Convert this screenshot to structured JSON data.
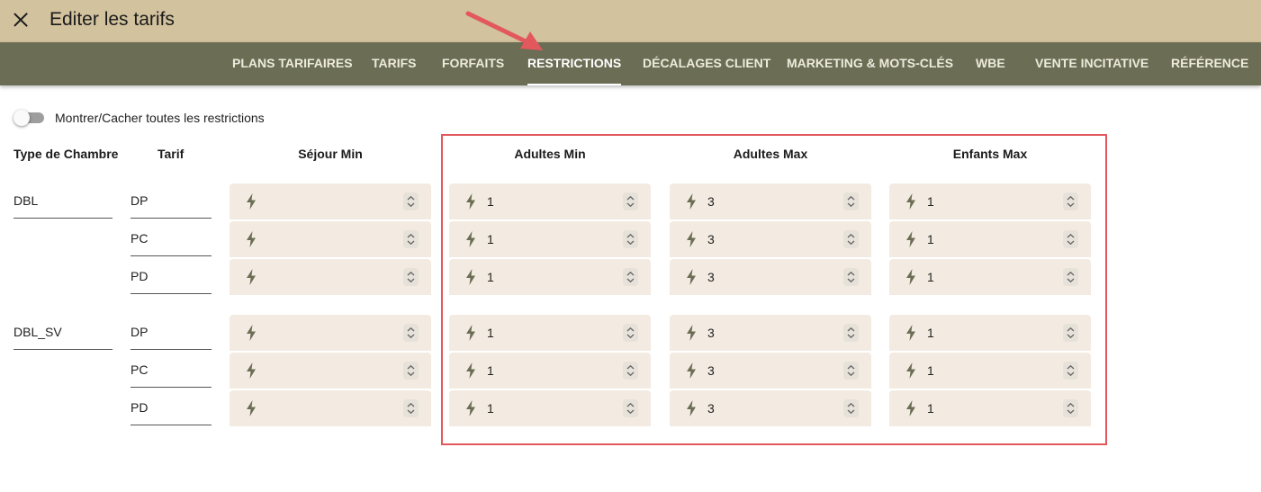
{
  "header": {
    "title": "Editer les tarifs"
  },
  "nav": {
    "tabs": [
      {
        "label": "PLANS TARIFAIRES"
      },
      {
        "label": "TARIFS"
      },
      {
        "label": "FORFAITS"
      },
      {
        "label": "RESTRICTIONS"
      },
      {
        "label": "DÉCALAGES CLIENT"
      },
      {
        "label": "MARKETING & MOTS-CLÉS"
      },
      {
        "label": "WBE"
      },
      {
        "label": "VENTE INCITATIVE"
      },
      {
        "label": "RÉFÉRENCE"
      }
    ],
    "active": "RESTRICTIONS"
  },
  "toggle": {
    "label": "Montrer/Cacher toutes les restrictions",
    "checked": false
  },
  "columns": {
    "room_type": "Type de Chambre",
    "tarif": "Tarif",
    "sejour_min": "Séjour Min",
    "adultes_min": "Adultes Min",
    "adultes_max": "Adultes Max",
    "enfants_max": "Enfants Max"
  },
  "rooms": [
    {
      "name": "DBL",
      "rows": [
        {
          "tarif": "DP",
          "sejour_min": "",
          "adultes_min": "1",
          "adultes_max": "3",
          "enfants_max": "1"
        },
        {
          "tarif": "PC",
          "sejour_min": "",
          "adultes_min": "1",
          "adultes_max": "3",
          "enfants_max": "1"
        },
        {
          "tarif": "PD",
          "sejour_min": "",
          "adultes_min": "1",
          "adultes_max": "3",
          "enfants_max": "1"
        }
      ]
    },
    {
      "name": "DBL_SV",
      "rows": [
        {
          "tarif": "DP",
          "sejour_min": "",
          "adultes_min": "1",
          "adultes_max": "3",
          "enfants_max": "1"
        },
        {
          "tarif": "PC",
          "sejour_min": "",
          "adultes_min": "1",
          "adultes_max": "3",
          "enfants_max": "1"
        },
        {
          "tarif": "PD",
          "sejour_min": "",
          "adultes_min": "1",
          "adultes_max": "3",
          "enfants_max": "1"
        }
      ]
    }
  ],
  "icons": {
    "close": "close-icon",
    "restriction": "lightning-bolt-icon",
    "stepper": "unfold-icon"
  },
  "colors": {
    "header_bg": "#d2c29d",
    "nav_bg": "#6b6e54",
    "cell_bg": "#f3ebe2",
    "bolt": "#6b6e54",
    "annotation": "#e2585d"
  }
}
